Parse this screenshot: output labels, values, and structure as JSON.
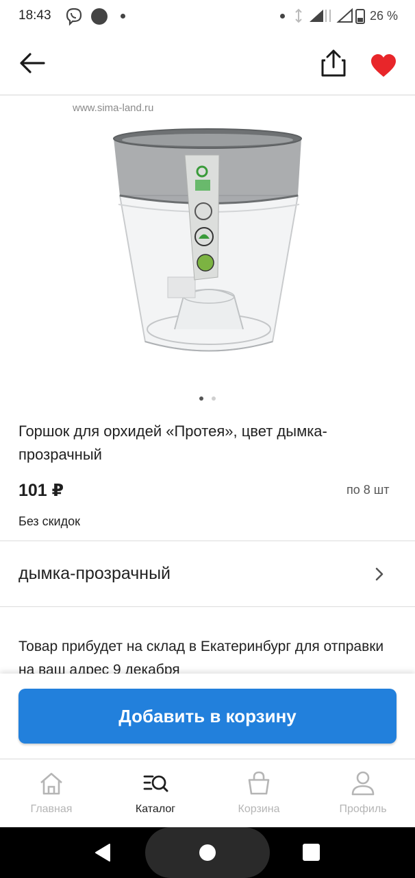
{
  "status_bar": {
    "time": "18:43",
    "battery": "26 %",
    "icons": [
      "viber-icon",
      "notification-dot-icon",
      "signal-icon",
      "battery-icon"
    ]
  },
  "app_bar": {
    "back_icon": "arrow-left-icon",
    "share_icon": "share-icon",
    "favorite_icon": "heart-icon",
    "favorite_color": "#e8262a"
  },
  "product": {
    "watermark": "www.sima-land.ru",
    "image_pages": 2,
    "active_page": 1,
    "title": "Горшок для орхидей «Протея», цвет дымка-прозрачный",
    "price": "101 ₽",
    "pack_note": "по 8 шт",
    "discount_note": "Без скидок",
    "variant": "дымка-прозрачный",
    "delivery_text": "Товар прибудет на склад в Екатеринбург для отправки на ваш адрес 9 декабря"
  },
  "actions": {
    "add_to_cart": "Добавить в корзину",
    "accent_color": "#2280dc"
  },
  "bottom_nav": {
    "items": [
      {
        "label": "Главная",
        "icon": "home-icon",
        "active": false
      },
      {
        "label": "Каталог",
        "icon": "catalog-search-icon",
        "active": true
      },
      {
        "label": "Корзина",
        "icon": "basket-icon",
        "active": false
      },
      {
        "label": "Профиль",
        "icon": "profile-icon",
        "active": false
      }
    ]
  }
}
